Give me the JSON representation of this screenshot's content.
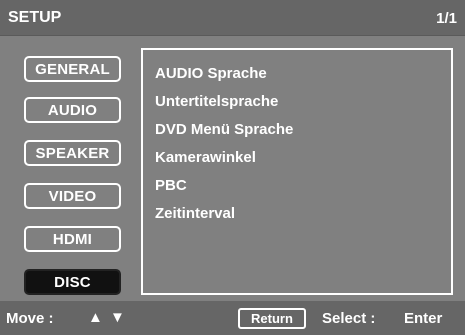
{
  "header": {
    "title": "SETUP",
    "page_indicator": "1/1"
  },
  "menu": {
    "items": [
      {
        "label": "GENERAL",
        "selected": false
      },
      {
        "label": "AUDIO",
        "selected": false
      },
      {
        "label": "SPEAKER",
        "selected": false
      },
      {
        "label": "VIDEO",
        "selected": false
      },
      {
        "label": "HDMI",
        "selected": false
      },
      {
        "label": "DISC",
        "selected": true
      }
    ]
  },
  "panel": {
    "options": [
      "AUDIO Sprache",
      "Untertitelsprache",
      "DVD Menü Sprache",
      "Kamerawinkel",
      "PBC",
      "Zeitinterval"
    ]
  },
  "footer": {
    "move_label": "Move :",
    "up_arrow": "▲",
    "down_arrow": "▼",
    "return_label": "Return",
    "select_label": "Select :",
    "enter_label": "Enter"
  },
  "colors": {
    "background": "#808080",
    "bars": "#666666",
    "selected": "#111111",
    "text": "#ffffff"
  }
}
